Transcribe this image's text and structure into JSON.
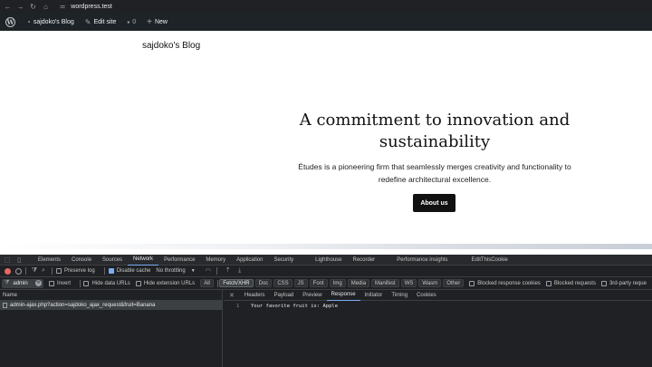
{
  "browser": {
    "url": "wordpress.test",
    "icons": [
      "back-arrow-icon",
      "forward-arrow-icon",
      "reload-icon",
      "home-icon",
      "site-settings-icon"
    ]
  },
  "admin_bar": {
    "site_name": "sajdoko's Blog",
    "edit_site": "Edit site",
    "comments_count": "0",
    "new_label": "New"
  },
  "site": {
    "title": "sajdoko's Blog",
    "heading": "A commitment to innovation and sustainability",
    "text": "Études is a pioneering firm that seamlessly merges creativity and functionality to redefine architectural excellence.",
    "button": "About us"
  },
  "devtools": {
    "tabs": [
      "Elements",
      "Console",
      "Sources",
      "Network",
      "Performance",
      "Memory",
      "Application",
      "Security",
      "Lighthouse",
      "Recorder",
      "Performance insights",
      "EditThisCookie"
    ],
    "active_tab": "Network",
    "toolbar": {
      "preserve_log": "Preserve log",
      "disable_cache": "Disable cache",
      "throttling": "No throttling"
    },
    "filter": {
      "value": "admin",
      "invert": "Invert",
      "hide_data_urls": "Hide data URLs",
      "hide_extension_urls": "Hide extension URLs",
      "types": [
        "All",
        "Fetch/XHR",
        "Doc",
        "CSS",
        "JS",
        "Font",
        "Img",
        "Media",
        "Manifest",
        "WS",
        "Wasm",
        "Other"
      ],
      "active_type": "Fetch/XHR",
      "blocked_response_cookies": "Blocked response cookies",
      "blocked_requests": "Blocked requests",
      "third_party": "3rd-party reque"
    },
    "name_header": "Name",
    "request": "admin-ajax.php?action=sajdoko_ajax_request&fruit=Banana",
    "detail_tabs": [
      "Headers",
      "Payload",
      "Preview",
      "Response",
      "Initiator",
      "Timing",
      "Cookies"
    ],
    "active_detail_tab": "Response",
    "response": {
      "line": "1",
      "text": "Your favorite fruit is: Apple"
    }
  }
}
